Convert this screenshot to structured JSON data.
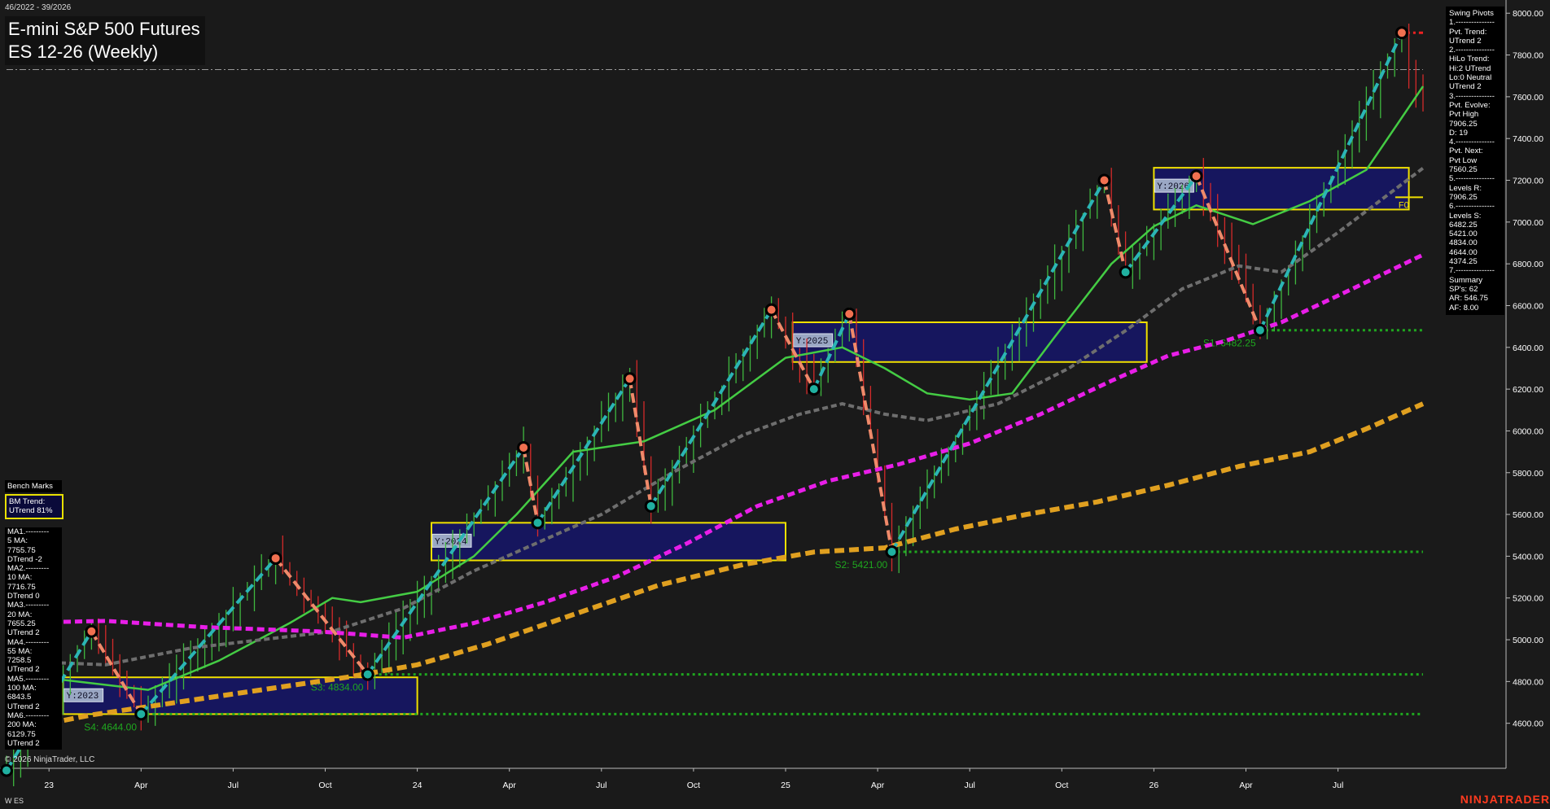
{
  "header": {
    "date_range": "46/2022 - 39/2026",
    "title_line1": "E-mini S&P 500 Futures",
    "title_line2": "ES 12-26 (Weekly)"
  },
  "swing_pivots": [
    "Swing Pivots",
    "1.---------------",
    "Pvt. Trend:",
    "UTrend 2",
    "2.---------------",
    "HiLo Trend:",
    "Hi:2 UTrend",
    "Lo:0 Neutral",
    "UTrend 2",
    "3.---------------",
    "Pvt. Evolve:",
    "Pvt High",
    "7906.25",
    "D: 19",
    "4.---------------",
    "Pvt. Next:",
    "Pvt Low",
    "7560.25",
    "5.---------------",
    "Levels R:",
    "7906.25",
    "6.---------------",
    "Levels S:",
    "6482.25",
    "5421.00",
    "4834.00",
    "4644.00",
    "4374.25",
    "7.---------------",
    "Summary",
    "SP's: 62",
    "AR: 546.75",
    "AF: 8.00"
  ],
  "bench_marks": {
    "title": "Bench Marks",
    "trend": [
      "BM Trend:",
      "UTrend 81%"
    ],
    "lines": [
      "MA1.---------",
      "5 MA:",
      "7755.75",
      "DTrend -2",
      "MA2.---------",
      "10 MA:",
      "7716.75",
      "DTrend 0",
      "MA3.---------",
      "20 MA:",
      "7655.25",
      "UTrend 2",
      "MA4.---------",
      "55 MA:",
      "7258.5",
      "UTrend 2",
      "MA5.---------",
      "100 MA:",
      "6843.5",
      "UTrend 2",
      "MA6.---------",
      "200 MA:",
      "6129.75",
      "UTrend 2"
    ]
  },
  "footer": {
    "copyright": "© 2026 NinjaTrader, LLC",
    "instrument": "W ES",
    "brand": "NINJATRADER"
  },
  "colors": {
    "background": "#1a1a1a",
    "up_bar": "#3fb83f",
    "down_bar": "#d42a2a",
    "ma_green": "#44cc44",
    "ma_gray": "#6e6e6e",
    "ma_magenta": "#e81ee8",
    "ma_gold": "#e0a020",
    "swing_up": "#2bb5b5",
    "swing_down": "#f08a6a",
    "support": "#1fa81f",
    "resistance": "#ee2222",
    "year_box_fill": "#16165e",
    "year_box_border": "#f0e000"
  },
  "chart_data": {
    "type": "line",
    "title": "E-mini S&P 500 Futures",
    "subtitle": "ES 12-26 (Weekly)",
    "y_axis": {
      "min": 4400,
      "max": 8100,
      "tick_labels": [
        "4600.00",
        "4800.00",
        "5000.00",
        "5200.00",
        "5400.00",
        "5600.00",
        "5800.00",
        "6000.00",
        "6200.00",
        "6400.00",
        "6600.00",
        "6800.00",
        "7000.00",
        "7200.00",
        "7400.00",
        "7600.00",
        "7800.00",
        "8000.00"
      ]
    },
    "x_axis": {
      "tick_labels": [
        "23",
        "Apr",
        "Jul",
        "Oct",
        "24",
        "Apr",
        "Jul",
        "Oct",
        "25",
        "Apr",
        "Jul",
        "Oct",
        "26",
        "Apr",
        "Jul"
      ],
      "tick_weeks": [
        6,
        19,
        32,
        45,
        58,
        71,
        84,
        97,
        110,
        123,
        136,
        149,
        162,
        175,
        188
      ],
      "week_count": 201
    },
    "swing_pivots": [
      {
        "week": 0,
        "price": 4374.25,
        "kind": "low"
      },
      {
        "week": 12,
        "price": 5040,
        "kind": "high"
      },
      {
        "week": 19,
        "price": 4644.0,
        "kind": "low"
      },
      {
        "week": 38,
        "price": 5390,
        "kind": "high"
      },
      {
        "week": 51,
        "price": 4834.0,
        "kind": "low"
      },
      {
        "week": 73,
        "price": 5920,
        "kind": "high"
      },
      {
        "week": 75,
        "price": 5560,
        "kind": "low"
      },
      {
        "week": 88,
        "price": 6250,
        "kind": "high"
      },
      {
        "week": 91,
        "price": 5640,
        "kind": "low"
      },
      {
        "week": 108,
        "price": 6580,
        "kind": "high"
      },
      {
        "week": 114,
        "price": 6200,
        "kind": "low"
      },
      {
        "week": 119,
        "price": 6560,
        "kind": "high"
      },
      {
        "week": 125,
        "price": 5421.0,
        "kind": "low"
      },
      {
        "week": 155,
        "price": 7200,
        "kind": "high"
      },
      {
        "week": 158,
        "price": 6760,
        "kind": "low"
      },
      {
        "week": 168,
        "price": 7220,
        "kind": "high"
      },
      {
        "week": 177,
        "price": 6482.25,
        "kind": "low"
      },
      {
        "week": 197,
        "price": 7906.25,
        "kind": "high"
      }
    ],
    "moving_averages": [
      {
        "name": "20 MA",
        "points": [
          [
            0,
            4840
          ],
          [
            10,
            4800
          ],
          [
            20,
            4760
          ],
          [
            30,
            4900
          ],
          [
            40,
            5080
          ],
          [
            46,
            5200
          ],
          [
            50,
            5180
          ],
          [
            58,
            5230
          ],
          [
            66,
            5400
          ],
          [
            72,
            5600
          ],
          [
            80,
            5900
          ],
          [
            90,
            5950
          ],
          [
            100,
            6100
          ],
          [
            110,
            6350
          ],
          [
            118,
            6400
          ],
          [
            124,
            6300
          ],
          [
            130,
            6180
          ],
          [
            136,
            6150
          ],
          [
            142,
            6180
          ],
          [
            148,
            6450
          ],
          [
            156,
            6800
          ],
          [
            162,
            6980
          ],
          [
            168,
            7080
          ],
          [
            176,
            6990
          ],
          [
            184,
            7100
          ],
          [
            192,
            7250
          ],
          [
            200,
            7650
          ]
        ]
      },
      {
        "name": "55 MA",
        "points": [
          [
            0,
            4900
          ],
          [
            14,
            4880
          ],
          [
            26,
            4960
          ],
          [
            36,
            5000
          ],
          [
            46,
            5040
          ],
          [
            56,
            5150
          ],
          [
            66,
            5330
          ],
          [
            74,
            5450
          ],
          [
            84,
            5600
          ],
          [
            94,
            5800
          ],
          [
            104,
            5980
          ],
          [
            112,
            6080
          ],
          [
            118,
            6130
          ],
          [
            124,
            6080
          ],
          [
            130,
            6050
          ],
          [
            140,
            6130
          ],
          [
            150,
            6300
          ],
          [
            158,
            6480
          ],
          [
            166,
            6680
          ],
          [
            174,
            6790
          ],
          [
            180,
            6760
          ],
          [
            188,
            6950
          ],
          [
            200,
            7258
          ]
        ]
      },
      {
        "name": "100 MA",
        "points": [
          [
            0,
            5080
          ],
          [
            14,
            5090
          ],
          [
            28,
            5060
          ],
          [
            44,
            5040
          ],
          [
            56,
            5010
          ],
          [
            66,
            5080
          ],
          [
            76,
            5180
          ],
          [
            86,
            5300
          ],
          [
            96,
            5460
          ],
          [
            106,
            5640
          ],
          [
            116,
            5760
          ],
          [
            126,
            5840
          ],
          [
            136,
            5940
          ],
          [
            146,
            6080
          ],
          [
            156,
            6240
          ],
          [
            164,
            6360
          ],
          [
            172,
            6430
          ],
          [
            180,
            6520
          ],
          [
            190,
            6680
          ],
          [
            200,
            6843.5
          ]
        ]
      },
      {
        "name": "200 MA",
        "points": [
          [
            0,
            4560
          ],
          [
            12,
            4640
          ],
          [
            24,
            4700
          ],
          [
            36,
            4760
          ],
          [
            48,
            4820
          ],
          [
            58,
            4880
          ],
          [
            68,
            4980
          ],
          [
            80,
            5120
          ],
          [
            92,
            5260
          ],
          [
            104,
            5360
          ],
          [
            114,
            5420
          ],
          [
            124,
            5440
          ],
          [
            134,
            5530
          ],
          [
            144,
            5600
          ],
          [
            154,
            5660
          ],
          [
            164,
            5740
          ],
          [
            174,
            5830
          ],
          [
            184,
            5900
          ],
          [
            192,
            6010
          ],
          [
            200,
            6129.75
          ]
        ]
      }
    ],
    "support_levels": [
      {
        "label": "S1: 6482.25",
        "price": 6482.25,
        "from_week": 177
      },
      {
        "label": "S2: 5421.00",
        "price": 5421.0,
        "from_week": 125
      },
      {
        "label": "S3: 4834.00",
        "price": 4834.0,
        "from_week": 51
      },
      {
        "label": "S4: 4644.00",
        "price": 4644.0,
        "from_week": 19
      }
    ],
    "resistance_level": {
      "price": 7906.25,
      "from_week": 197
    },
    "reference_line": {
      "price": 7730
    },
    "year_boxes": [
      {
        "label": "Y:2023",
        "from_week": 8,
        "to_week": 58,
        "low": 4644.0,
        "high": 4820
      },
      {
        "label": "Y:2024",
        "from_week": 60,
        "to_week": 110,
        "low": 5380,
        "high": 5560
      },
      {
        "label": "Y:2025",
        "from_week": 111,
        "to_week": 161,
        "low": 6330,
        "high": 6520
      },
      {
        "label": "Y:2026",
        "from_week": 162,
        "to_week": 198,
        "low": 7060,
        "high": 7260
      }
    ],
    "f0_marker": {
      "label": "F0",
      "price": 7150,
      "week": 197
    }
  }
}
